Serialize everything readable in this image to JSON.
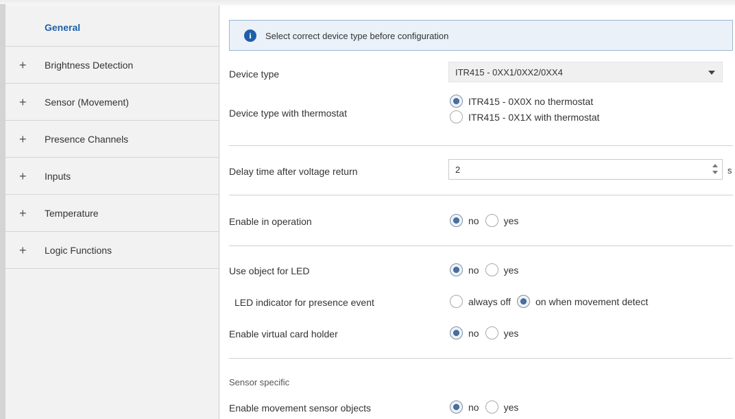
{
  "sidebar": {
    "items": [
      {
        "label": "General",
        "expandable": false,
        "active": true
      },
      {
        "label": "Brightness Detection",
        "expandable": true
      },
      {
        "label": "Sensor (Movement)",
        "expandable": true
      },
      {
        "label": "Presence Channels",
        "expandable": true
      },
      {
        "label": "Inputs",
        "expandable": true
      },
      {
        "label": "Temperature",
        "expandable": true
      },
      {
        "label": "Logic Functions",
        "expandable": true
      }
    ],
    "expand_glyph": "+"
  },
  "info": {
    "icon": "info-icon",
    "icon_glyph": "i",
    "text": "Select correct device type before configuration"
  },
  "device_type": {
    "label": "Device type",
    "value": "ITR415 - 0XX1/0XX2/0XX4"
  },
  "device_type_thermostat": {
    "label": "Device type with thermostat",
    "options": [
      "ITR415 - 0X0X no thermostat",
      "ITR415 - 0X1X with thermostat"
    ],
    "selected": "ITR415 - 0X0X no thermostat"
  },
  "delay_time": {
    "label": "Delay time after voltage return",
    "value": "2",
    "unit": "s"
  },
  "enable_in_operation": {
    "label": "Enable in operation",
    "options": [
      "no",
      "yes"
    ],
    "selected": "no"
  },
  "use_object_led": {
    "label": "Use object for LED",
    "options": [
      "no",
      "yes"
    ],
    "selected": "no"
  },
  "led_indicator": {
    "label": "LED indicator for presence event",
    "options": [
      "always off",
      "on when movement detect"
    ],
    "selected": "on when movement detect"
  },
  "virtual_card_holder": {
    "label": "Enable virtual card holder",
    "options": [
      "no",
      "yes"
    ],
    "selected": "no"
  },
  "sensor_specific": {
    "title": "Sensor specific"
  },
  "movement_sensor_objects": {
    "label": "Enable movement sensor objects",
    "options": [
      "no",
      "yes"
    ],
    "selected": "no"
  },
  "colors": {
    "accent": "#1f5fa8",
    "sidebar_bg": "#f2f2f2",
    "info_bg": "#eaf1f8",
    "info_border": "#9ab6d1",
    "radio_selected": "#4a6fa0"
  }
}
